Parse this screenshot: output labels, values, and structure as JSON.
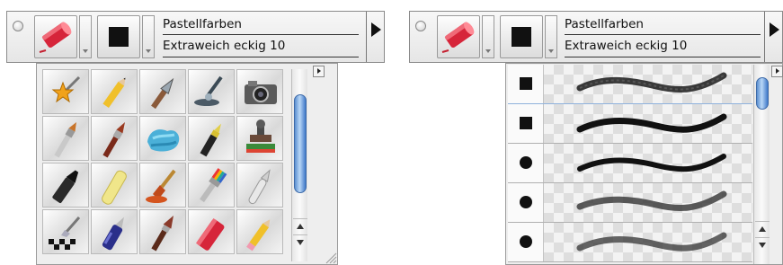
{
  "left_panel": {
    "tool_name": "Pastellfarben",
    "variant_name": "Extraweich eckig 10",
    "grid_icons": [
      [
        "star-wand-icon",
        "pencil-icon",
        "ink-pen-icon",
        "calligraphy-pen-icon",
        "camera-icon"
      ],
      [
        "oil-brush-icon",
        "acrylic-brush-icon",
        "blue-paint-blob-icon",
        "felt-pen-icon",
        "stamp-icon"
      ],
      [
        "black-marker-icon",
        "chalk-icon",
        "paint-tube-brush-icon",
        "rainbow-brush-icon",
        "airbrush-icon"
      ],
      [
        "pattern-pen-icon",
        "blue-ink-pen-icon",
        "watercolor-brush-icon",
        "pastel-chalk-icon",
        "eraser-pencil-icon"
      ]
    ]
  },
  "right_panel": {
    "tool_name": "Pastellfarben",
    "variant_name": "Extraweich eckig 10",
    "variants": [
      {
        "shape": "square",
        "selected": true
      },
      {
        "shape": "square",
        "selected": false
      },
      {
        "shape": "round",
        "selected": false
      },
      {
        "shape": "round",
        "selected": false
      },
      {
        "shape": "round",
        "selected": false
      }
    ]
  },
  "colors": {
    "scroll_thumb": "#5b8fd0",
    "selection": "#8fb2dc",
    "stroke": "#1a1a1a"
  }
}
